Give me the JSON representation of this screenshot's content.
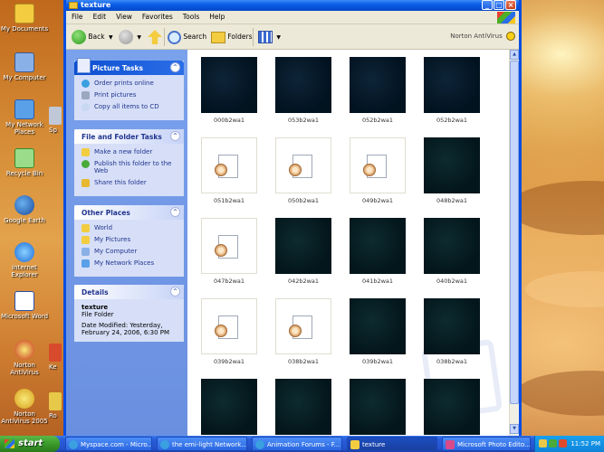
{
  "window": {
    "title": "texture",
    "menu": [
      "File",
      "Edit",
      "View",
      "Favorites",
      "Tools",
      "Help"
    ],
    "toolbar": {
      "back": "Back",
      "search": "Search",
      "folders": "Folders",
      "norton": "Norton AntiVirus"
    }
  },
  "taskpane": {
    "picture_tasks": {
      "title": "Picture Tasks",
      "items": [
        "Order prints online",
        "Print pictures",
        "Copy all items to CD"
      ]
    },
    "file_tasks": {
      "title": "File and Folder Tasks",
      "items": [
        "Make a new folder",
        "Publish this folder to the Web",
        "Share this folder"
      ]
    },
    "other_places": {
      "title": "Other Places",
      "items": [
        "World",
        "My Pictures",
        "My Computer",
        "My Network Places"
      ]
    },
    "details": {
      "title": "Details",
      "name": "texture",
      "type": "File Folder",
      "modified": "Date Modified: Yesterday, February 24, 2006, 6:30 PM"
    }
  },
  "files": [
    {
      "name": "000b2wa1",
      "kind": "texture-blue"
    },
    {
      "name": "053b2wa1",
      "kind": "texture-blue"
    },
    {
      "name": "052b2wa1",
      "kind": "texture-blue"
    },
    {
      "name": "052b2wa1",
      "kind": "texture-blue"
    },
    {
      "name": "051b2wa1",
      "kind": "generic"
    },
    {
      "name": "050b2wa1",
      "kind": "generic"
    },
    {
      "name": "049b2wa1",
      "kind": "generic"
    },
    {
      "name": "048b2wa1",
      "kind": "texture"
    },
    {
      "name": "047b2wa1",
      "kind": "generic"
    },
    {
      "name": "042b2wa1",
      "kind": "texture"
    },
    {
      "name": "041b2wa1",
      "kind": "texture"
    },
    {
      "name": "040b2wa1",
      "kind": "texture"
    },
    {
      "name": "039b2wa1",
      "kind": "generic"
    },
    {
      "name": "038b2wa1",
      "kind": "generic"
    },
    {
      "name": "039b2wa1",
      "kind": "texture"
    },
    {
      "name": "038b2wa1",
      "kind": "texture"
    },
    {
      "name": "",
      "kind": "texture"
    },
    {
      "name": "",
      "kind": "texture"
    },
    {
      "name": "",
      "kind": "texture"
    },
    {
      "name": "",
      "kind": "texture"
    }
  ],
  "desktop": {
    "icons": [
      "My Documents",
      "My Computer",
      "My Network Places",
      "Recycle Bin",
      "Google Earth",
      "Internet Explorer",
      "Microsoft Word",
      "Norton AntiVirus",
      "Norton AntiVirus 2005"
    ],
    "icons2": [
      "Sp",
      "",
      "",
      "",
      "",
      "",
      "",
      "Ke",
      "Ro"
    ]
  },
  "taskbar": {
    "start": "start",
    "buttons": [
      "Myspace.com - Micro...",
      "the emi-light Network...",
      "Animation Forums - F...",
      "texture",
      "Microsoft Photo Edito..."
    ],
    "clock": "11:52 PM"
  }
}
